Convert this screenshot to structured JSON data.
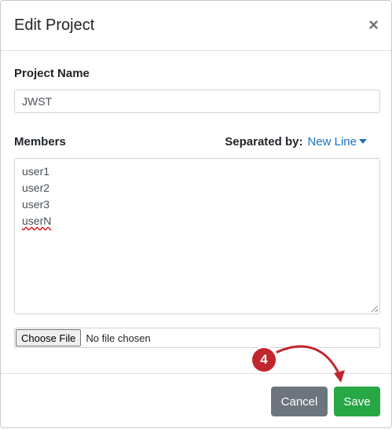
{
  "dialog": {
    "title": "Edit Project",
    "close_symbol": "×"
  },
  "project": {
    "label": "Project Name",
    "value": "JWST"
  },
  "members": {
    "label": "Members",
    "separator_label": "Separated by:",
    "separator_value": "New Line",
    "lines": [
      "user1",
      "user2",
      "user3",
      "userN"
    ]
  },
  "file": {
    "button_label": "Choose File",
    "status": "No file chosen"
  },
  "footer": {
    "cancel_label": "Cancel",
    "save_label": "Save"
  },
  "annotation": {
    "step_number": "4",
    "color": "#c0272d"
  },
  "colors": {
    "link": "#1a6fc1",
    "cancel": "#6c757d",
    "save": "#28a745"
  }
}
